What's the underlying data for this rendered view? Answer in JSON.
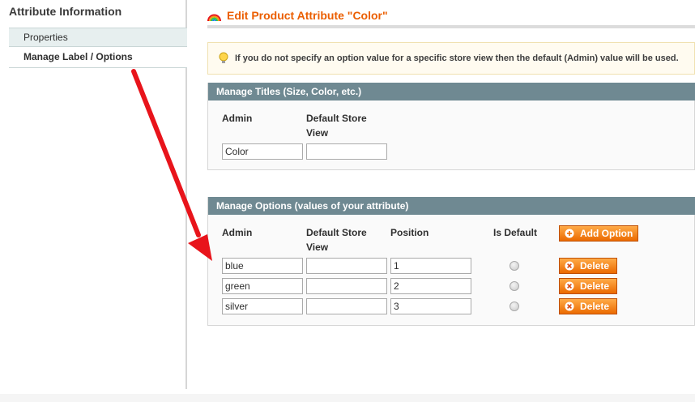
{
  "sidebar": {
    "title": "Attribute Information",
    "tabs": [
      {
        "label": "Properties"
      },
      {
        "label": "Manage Label / Options"
      }
    ]
  },
  "page": {
    "title": "Edit Product Attribute \"Color\""
  },
  "notice": {
    "text": "If you do not specify an option value for a specific store view then the default (Admin) value will be used."
  },
  "titles_section": {
    "header": "Manage Titles (Size, Color, etc.)",
    "columns": [
      "Admin",
      "Default Store View"
    ],
    "values": {
      "admin": "Color",
      "default_store": ""
    }
  },
  "options_section": {
    "header": "Manage Options (values of your attribute)",
    "columns": [
      "Admin",
      "Default Store View",
      "Position",
      "Is Default"
    ],
    "add_button": "Add Option",
    "delete_label": "Delete",
    "rows": [
      {
        "admin": "blue",
        "default_store": "",
        "position": "1"
      },
      {
        "admin": "green",
        "default_store": "",
        "position": "2"
      },
      {
        "admin": "silver",
        "default_store": "",
        "position": "3"
      }
    ]
  },
  "colors": {
    "accent": "#eb5e00",
    "section_header": "#6f8992",
    "annotation_arrow": "#e8141b"
  }
}
